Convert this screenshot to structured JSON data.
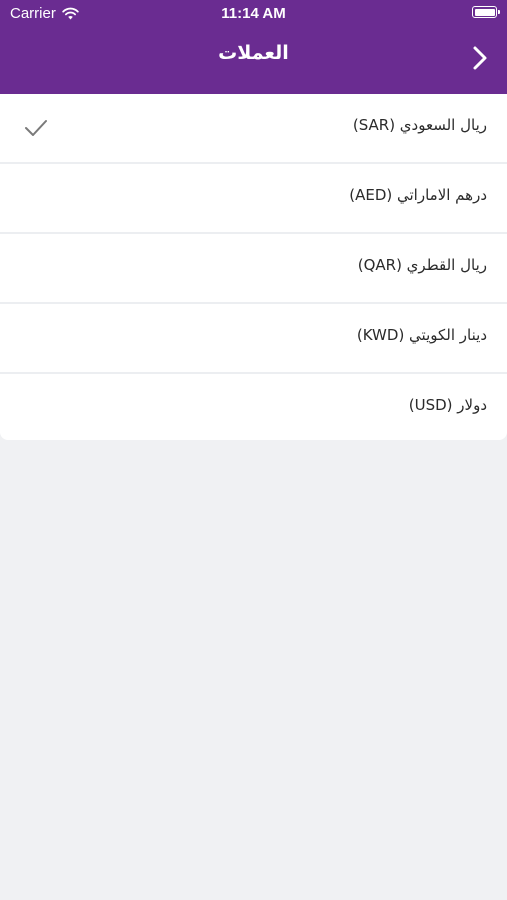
{
  "theme": {
    "brand": "#6a2c91"
  },
  "status_bar": {
    "carrier": "Carrier",
    "time": "11:14 AM"
  },
  "nav": {
    "title": "العملات",
    "back_icon": "chevron-right-icon"
  },
  "currencies": [
    {
      "label": "ريال السعودي (SAR)",
      "selected": true
    },
    {
      "label": "درهم الاماراتي (AED)",
      "selected": false
    },
    {
      "label": "ريال القطري (QAR)",
      "selected": false
    },
    {
      "label": "دينار الكويتي (KWD)",
      "selected": false
    },
    {
      "label": "دولار (USD)",
      "selected": false
    }
  ]
}
